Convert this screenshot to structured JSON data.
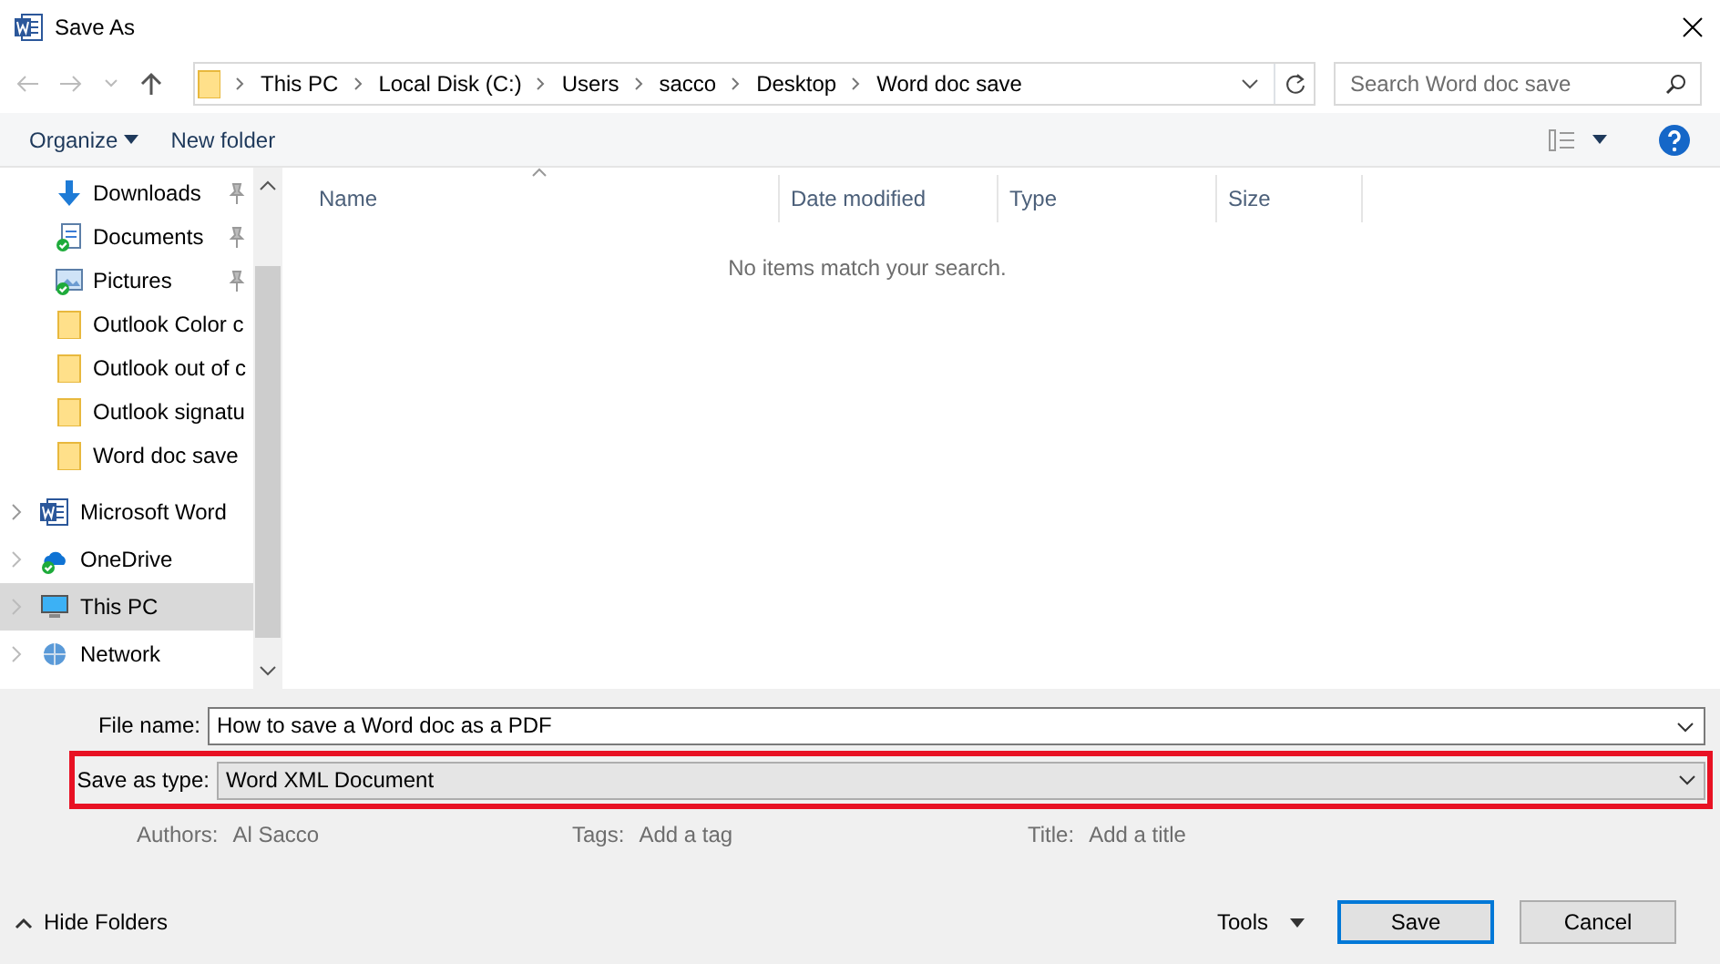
{
  "window": {
    "title": "Save As"
  },
  "breadcrumb": [
    "This PC",
    "Local Disk (C:)",
    "Users",
    "sacco",
    "Desktop",
    "Word doc save"
  ],
  "search": {
    "placeholder": "Search Word doc save"
  },
  "toolbar": {
    "organize": "Organize",
    "new_folder": "New folder"
  },
  "pinned_items": [
    {
      "label": "Downloads",
      "kind": "downloads",
      "pinned": true
    },
    {
      "label": "Documents",
      "kind": "documents",
      "pinned": true
    },
    {
      "label": "Pictures",
      "kind": "pictures",
      "pinned": true
    },
    {
      "label": "Outlook Color c",
      "kind": "folder",
      "pinned": false
    },
    {
      "label": "Outlook out of c",
      "kind": "folder",
      "pinned": false
    },
    {
      "label": "Outlook signatu",
      "kind": "folder",
      "pinned": false
    },
    {
      "label": "Word doc save",
      "kind": "folder",
      "pinned": false
    }
  ],
  "locations": [
    {
      "label": "Microsoft Word",
      "kind": "word",
      "selected": false
    },
    {
      "label": "OneDrive",
      "kind": "onedrive",
      "selected": false
    },
    {
      "label": "This PC",
      "kind": "pc",
      "selected": true
    },
    {
      "label": "Network",
      "kind": "network",
      "selected": false
    }
  ],
  "table": {
    "columns": [
      "Name",
      "Date modified",
      "Type",
      "Size"
    ],
    "empty_message": "No items match your search."
  },
  "file_name": {
    "label": "File name:",
    "value": "How to save a Word doc as a PDF"
  },
  "save_as_type": {
    "label": "Save as type:",
    "value": "Word XML Document",
    "highlighted": true
  },
  "metadata": [
    {
      "label": "Authors:",
      "value": "Al Sacco"
    },
    {
      "label": "Tags:",
      "value": "Add a tag"
    },
    {
      "label": "Title:",
      "value": "Add a title"
    }
  ],
  "hide_folders": "Hide Folders",
  "buttons": [
    {
      "label": "Tools",
      "kind": "menu"
    },
    {
      "label": "Save",
      "kind": "default"
    },
    {
      "label": "Cancel",
      "kind": "plain"
    }
  ]
}
